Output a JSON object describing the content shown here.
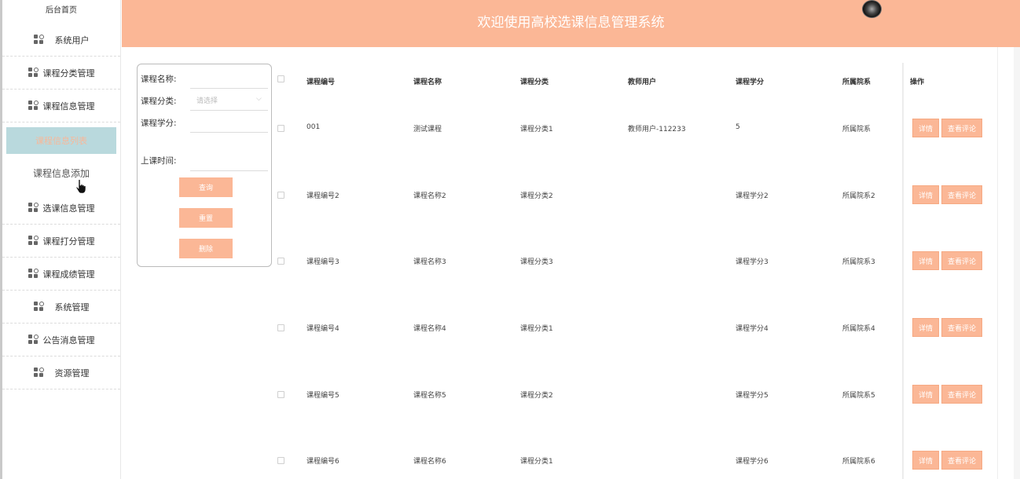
{
  "header": {
    "title": "欢迎使用高校选课信息管理系统"
  },
  "sidebar": {
    "home": "后台首页",
    "items_top": [
      {
        "label": "系统用户",
        "wide": true
      },
      {
        "label": "课程分类管理",
        "wide": false
      },
      {
        "label": "课程信息管理",
        "wide": false
      }
    ],
    "sub_active": "课程信息列表",
    "sub_add": "课程信息添加",
    "items_bottom": [
      {
        "label": "选课信息管理",
        "wide": false
      },
      {
        "label": "课程打分管理",
        "wide": false
      },
      {
        "label": "课程成绩管理",
        "wide": false
      },
      {
        "label": "系统管理",
        "wide": true
      },
      {
        "label": "公告消息管理",
        "wide": false
      },
      {
        "label": "资源管理",
        "wide": true
      }
    ]
  },
  "search": {
    "name_label": "课程名称:",
    "category_label": "课程分类:",
    "category_placeholder": "请选择",
    "credit_label": "课程学分:",
    "time_label": "上课时间:",
    "query_button": "查询",
    "reset_button": "重置",
    "delete_button": "删除"
  },
  "table": {
    "headers": [
      "课程编号",
      "课程名称",
      "课程分类",
      "教师用户",
      "课程学分",
      "所属院系",
      "操作"
    ],
    "detail_label": "详情",
    "review_label": "查看评论",
    "rows": [
      [
        "001",
        "测试课程",
        "课程分类1",
        "教师用户-112233",
        "5",
        "所属院系"
      ],
      [
        "课程编号2",
        "课程名称2",
        "课程分类2",
        "",
        "课程学分2",
        "所属院系2"
      ],
      [
        "课程编号3",
        "课程名称3",
        "课程分类3",
        "",
        "课程学分3",
        "所属院系3"
      ],
      [
        "课程编号4",
        "课程名称4",
        "课程分类1",
        "",
        "课程学分4",
        "所属院系4"
      ],
      [
        "课程编号5",
        "课程名称5",
        "课程分类2",
        "",
        "课程学分5",
        "所属院系5"
      ],
      [
        "课程编号6",
        "课程名称6",
        "课程分类1",
        "",
        "课程学分6",
        "所属院系6"
      ]
    ]
  },
  "colors": {
    "accent": "#fbb796",
    "sidebar_active": "#b9d9dd"
  }
}
